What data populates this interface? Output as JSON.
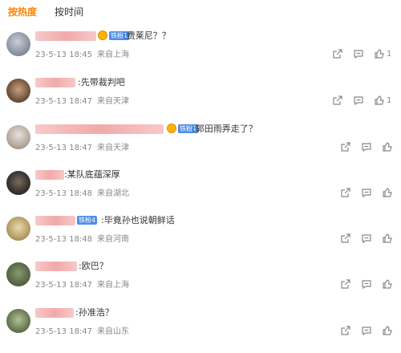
{
  "tabs": {
    "hot": "按热度",
    "time": "按时间"
  },
  "comments": [
    {
      "text": ":费莱尼？？",
      "badge": "铁粉1",
      "crown": true,
      "time": "23-5-13 18:45",
      "location": "来自上海",
      "likes": "1"
    },
    {
      "text": ":先带裁判吧",
      "badge": "",
      "crown": false,
      "time": "23-5-13 18:47",
      "location": "来自天津",
      "likes": "1"
    },
    {
      "text": ":郭田雨弄走了？",
      "badge": "铁粉1",
      "crown": true,
      "time": "23-5-13 18:47",
      "location": "来自天津",
      "likes": ""
    },
    {
      "text": ":某队底蕴深厚",
      "badge": "",
      "crown": false,
      "time": "23-5-13 18:48",
      "location": "来自湖北",
      "likes": ""
    },
    {
      "text": ":毕竟孙也说朝鲜话",
      "badge": "铁粉4",
      "crown": false,
      "time": "23-5-13 18:48",
      "location": "来自河南",
      "likes": ""
    },
    {
      "text": ":欧巴？",
      "badge": "",
      "crown": false,
      "time": "23-5-13 18:47",
      "location": "来自上海",
      "likes": ""
    },
    {
      "text": ":孙准浩？",
      "badge": "",
      "crown": false,
      "time": "23-5-13 18:47",
      "location": "来自山东",
      "likes": ""
    }
  ],
  "colors": {
    "accent": "#ff8200",
    "badge": "#4b8de8",
    "meta": "#888888"
  }
}
